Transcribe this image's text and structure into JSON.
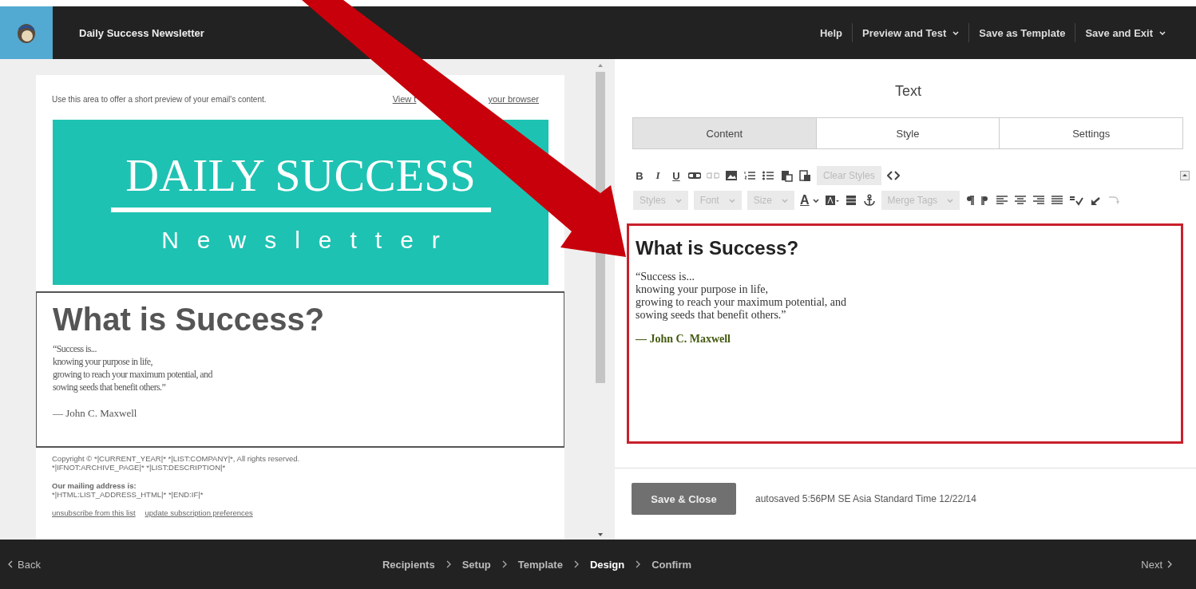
{
  "top_bar": {
    "campaign_title": "Daily Success Newsletter",
    "menu": [
      {
        "label": "Help",
        "dropdown": false
      },
      {
        "label": "Preview and Test",
        "dropdown": true
      },
      {
        "label": "Save as Template",
        "dropdown": false
      },
      {
        "label": "Save and Exit",
        "dropdown": true
      }
    ]
  },
  "preview": {
    "preheader": "Use this area to offer a short preview of your email's content.",
    "browser_link_parts": [
      "View t",
      "your browser"
    ],
    "header": {
      "title": "DAILY SUCCESS",
      "subtitle": "Newsletter"
    },
    "block": {
      "selected": true,
      "heading": "What is Success?",
      "quote_lines": [
        "“Success is...",
        "knowing your purpose in life,",
        "growing to reach your maximum potential, and",
        "sowing seeds that benefit others.”"
      ],
      "author": "— John C. Maxwell"
    },
    "footer": {
      "copyright_lines": [
        "Copyright © *|CURRENT_YEAR|* *|LIST:COMPANY|*, All rights reserved.",
        "*|IFNOT:ARCHIVE_PAGE|* *|LIST:DESCRIPTION|*"
      ],
      "address_label": "Our mailing address is:",
      "address_line": "*|HTML:LIST_ADDRESS_HTML|* *|END:IF|*",
      "links": [
        "unsubscribe from this list",
        "update subscription preferences"
      ]
    }
  },
  "editor": {
    "title": "Text",
    "tabs": [
      {
        "label": "Content",
        "selected": true
      },
      {
        "label": "Style",
        "selected": false
      },
      {
        "label": "Settings",
        "selected": false
      }
    ],
    "toolbar_rows": [
      [
        {
          "kind": "bold",
          "label": "B",
          "disabled": false
        },
        {
          "kind": "italic",
          "label": "I",
          "disabled": false
        },
        {
          "kind": "underline",
          "label": "U",
          "disabled": false
        },
        {
          "kind": "link",
          "disabled": false
        },
        {
          "kind": "unlink",
          "disabled": true
        },
        {
          "kind": "image",
          "disabled": false
        },
        {
          "kind": "ordered-list",
          "disabled": false
        },
        {
          "kind": "bullet-list",
          "disabled": false
        },
        {
          "kind": "paste",
          "disabled": false
        },
        {
          "kind": "paste-text",
          "disabled": false
        },
        {
          "kind": "button",
          "label": "Clear Styles",
          "disabled": true
        },
        {
          "kind": "code",
          "disabled": false
        }
      ],
      [
        {
          "kind": "dropdown",
          "label": "Styles",
          "disabled": true
        },
        {
          "kind": "dropdown",
          "label": "Font",
          "disabled": true
        },
        {
          "kind": "dropdown",
          "label": "Size",
          "disabled": true
        },
        {
          "kind": "text-color",
          "label": "A",
          "disabled": false
        },
        {
          "kind": "background-color",
          "disabled": false
        },
        {
          "kind": "table",
          "disabled": false
        },
        {
          "kind": "anchor",
          "disabled": false
        },
        {
          "kind": "dropdown",
          "label": "Merge Tags",
          "disabled": true
        },
        {
          "kind": "ltr",
          "disabled": false
        },
        {
          "kind": "rtl",
          "disabled": false
        },
        {
          "kind": "align-left",
          "disabled": false
        },
        {
          "kind": "align-center",
          "disabled": false
        },
        {
          "kind": "align-right",
          "disabled": false
        },
        {
          "kind": "justify",
          "disabled": false
        },
        {
          "kind": "spellcheck",
          "disabled": false
        },
        {
          "kind": "undo",
          "disabled": false
        },
        {
          "kind": "redo",
          "disabled": true
        }
      ]
    ],
    "content": {
      "heading": "What is Success?",
      "quote_lines": [
        "“Success is...",
        "knowing your purpose in life,",
        "growing to reach your maximum potential, and",
        "sowing seeds that benefit others.”"
      ],
      "author": "— John C. Maxwell"
    },
    "save_button": "Save & Close",
    "autosave_status": "autosaved 5:56PM SE Asia Standard Time 12/22/14"
  },
  "bottom_bar": {
    "back": "Back",
    "steps": [
      {
        "label": "Recipients",
        "selected": false
      },
      {
        "label": "Setup",
        "selected": false
      },
      {
        "label": "Template",
        "selected": false
      },
      {
        "label": "Design",
        "selected": true
      },
      {
        "label": "Confirm",
        "selected": false
      }
    ],
    "next": "Next"
  }
}
